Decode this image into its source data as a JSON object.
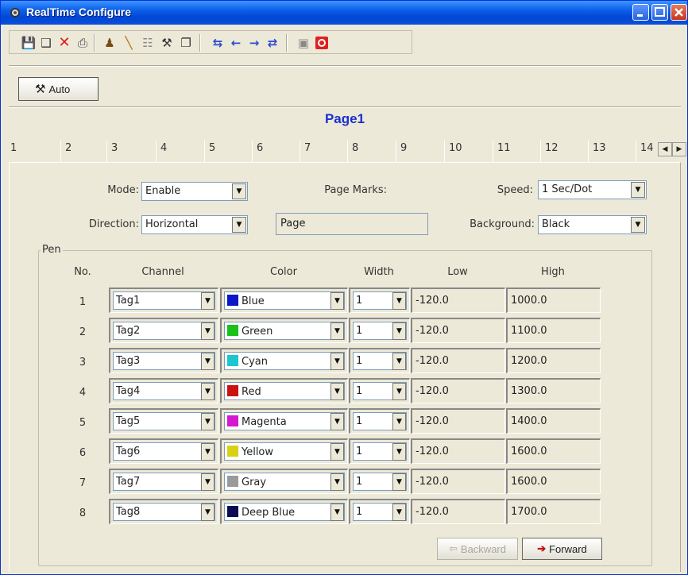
{
  "window": {
    "title": "RealTime Configure"
  },
  "toolbar": {
    "icons": [
      "save-icon",
      "save-as-icon",
      "delete-icon",
      "print-icon",
      "pen-icon",
      "draw-icon",
      "form-icon",
      "settings-icon",
      "export-icon",
      "move-first-icon",
      "move-left-icon",
      "move-right-icon",
      "move-last-icon",
      "info-icon",
      "stop-icon"
    ]
  },
  "auto_button": {
    "label": "Auto"
  },
  "page_title": "Page1",
  "tabs": [
    "1",
    "2",
    "3",
    "4",
    "5",
    "6",
    "7",
    "8",
    "9",
    "10",
    "11",
    "12",
    "13",
    "14"
  ],
  "settings": {
    "mode_label": "Mode:",
    "mode_value": "Enable",
    "page_marks_label": "Page Marks:",
    "page_marks_value": "Page",
    "speed_label": "Speed:",
    "speed_value": "1 Sec/Dot",
    "direction_label": "Direction:",
    "direction_value": "Horizontal",
    "background_label": "Background:",
    "background_value": "Black"
  },
  "pen": {
    "legend": "Pen",
    "headers": {
      "no": "No.",
      "channel": "Channel",
      "color": "Color",
      "width": "Width",
      "low": "Low",
      "high": "High"
    },
    "rows": [
      {
        "no": "1",
        "channel": "Tag1",
        "color": "Blue",
        "swatch": "#0a16c8",
        "width": "1",
        "low": "-120.0",
        "high": "1000.0"
      },
      {
        "no": "2",
        "channel": "Tag2",
        "color": "Green",
        "swatch": "#19c219",
        "width": "1",
        "low": "-120.0",
        "high": "1100.0"
      },
      {
        "no": "3",
        "channel": "Tag3",
        "color": "Cyan",
        "swatch": "#1cc6cf",
        "width": "1",
        "low": "-120.0",
        "high": "1200.0"
      },
      {
        "no": "4",
        "channel": "Tag4",
        "color": "Red",
        "swatch": "#cc1111",
        "width": "1",
        "low": "-120.0",
        "high": "1300.0"
      },
      {
        "no": "5",
        "channel": "Tag5",
        "color": "Magenta",
        "swatch": "#d418d1",
        "width": "1",
        "low": "-120.0",
        "high": "1400.0"
      },
      {
        "no": "6",
        "channel": "Tag6",
        "color": "Yellow",
        "swatch": "#d9d113",
        "width": "1",
        "low": "-120.0",
        "high": "1600.0"
      },
      {
        "no": "7",
        "channel": "Tag7",
        "color": "Gray",
        "swatch": "#9a9a9a",
        "width": "1",
        "low": "-120.0",
        "high": "1600.0"
      },
      {
        "no": "8",
        "channel": "Tag8",
        "color": "Deep Blue",
        "swatch": "#0b0b55",
        "width": "1",
        "low": "-120.0",
        "high": "1700.0"
      }
    ]
  },
  "nav": {
    "backward": "Backward",
    "forward": "Forward"
  }
}
